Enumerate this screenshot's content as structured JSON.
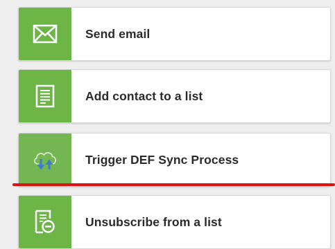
{
  "actions": [
    {
      "label": "Send email",
      "icon": "envelope-icon"
    },
    {
      "label": "Add contact to a list",
      "icon": "list-document-icon"
    },
    {
      "label": "Trigger DEF Sync Process",
      "icon": "cloud-sync-icon"
    },
    {
      "label": "Unsubscribe from a list",
      "icon": "document-remove-icon"
    }
  ],
  "colors": {
    "accent_green": "#6cb546",
    "drop_indicator": "#e01313",
    "sync_arrows": "#3d7fc7"
  }
}
